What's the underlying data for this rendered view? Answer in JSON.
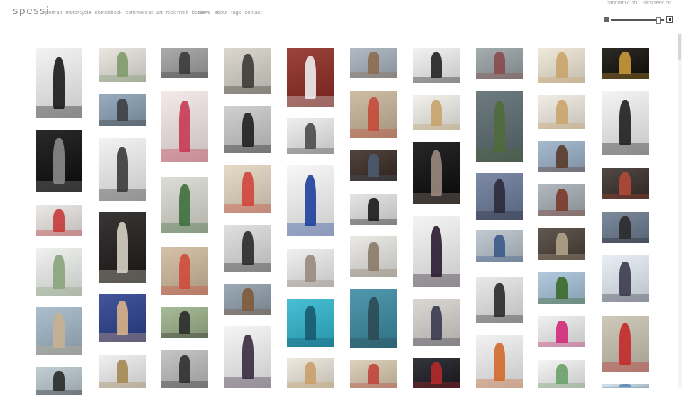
{
  "site": {
    "logo": "spessi",
    "nav": [
      "portrait",
      "motorcycle",
      "sketchbook",
      "commercial",
      "art",
      "rock'n'roll",
      "books"
    ],
    "nav_secondary": [
      "news",
      "about",
      "tags",
      "contact"
    ],
    "top_links": [
      "panoramic on",
      "fullscreen on"
    ]
  },
  "zoom": {
    "level": 0.88
  },
  "columns": [
    {
      "items": [
        {
          "name": "photo-man-in-black-studio",
          "colors": [
            "#f2f2f2",
            "#1a1a1a"
          ]
        },
        {
          "name": "photo-nude-man-dark",
          "colors": [
            "#0c0c0c",
            "#8a8a8a"
          ]
        },
        {
          "name": "photo-motorcycle-handlebars-poster",
          "colors": [
            "#e9e5e2",
            "#c53a3a"
          ]
        },
        {
          "name": "photo-album-cover-white",
          "colors": [
            "#eef0ed",
            "#8aa37c"
          ]
        },
        {
          "name": "photo-two-men-at-table",
          "colors": [
            "#a2b6c6",
            "#c7b190"
          ]
        },
        {
          "name": "photo-handlebars-sky",
          "colors": [
            "#b9c8cf",
            "#2a2a2a"
          ]
        }
      ]
    },
    {
      "items": [
        {
          "name": "photo-booklet-landscapes",
          "colors": [
            "#e6e4dc",
            "#7f9a6a"
          ]
        },
        {
          "name": "photo-motorcycle-rally-crowd",
          "colors": [
            "#8aa1b5",
            "#3d3f42"
          ]
        },
        {
          "name": "photo-boy-helmet-poster",
          "colors": [
            "#f1f1f1",
            "#3a3a3a"
          ]
        },
        {
          "name": "photo-blackboard-menu",
          "colors": [
            "#1e1a1a",
            "#d6d0c3"
          ]
        },
        {
          "name": "photo-mugshot-prisoner",
          "colors": [
            "#2a3f8e",
            "#d9b289"
          ]
        },
        {
          "name": "photo-bowl-and-spoon",
          "colors": [
            "#efefef",
            "#a48a52"
          ]
        }
      ]
    },
    {
      "items": [
        {
          "name": "photo-street-bw",
          "colors": [
            "#a0a0a0",
            "#3b3b3b"
          ]
        },
        {
          "name": "photo-spessi-poster-band",
          "colors": [
            "#f3e7e7",
            "#c73a54"
          ]
        },
        {
          "name": "photo-diner-sign-poster",
          "colors": [
            "#d8d9cf",
            "#3e6f3f"
          ]
        },
        {
          "name": "photo-two-women-at-table",
          "colors": [
            "#cfb99c",
            "#cf4a3c"
          ]
        },
        {
          "name": "photo-chopper-handlebar-road",
          "colors": [
            "#9cb28a",
            "#2b2b2b"
          ]
        },
        {
          "name": "photo-culture-book-cover",
          "colors": [
            "#bdbdbd",
            "#2f2f2f"
          ]
        }
      ]
    },
    {
      "items": [
        {
          "name": "photo-dancing-couple",
          "colors": [
            "#d6d2c9",
            "#3d3a36"
          ]
        },
        {
          "name": "photo-dragster-bw",
          "colors": [
            "#c9c9c9",
            "#1f1f1f"
          ]
        },
        {
          "name": "photo-two-girls-at-table",
          "colors": [
            "#e3d6c0",
            "#d0453a"
          ]
        },
        {
          "name": "photo-woman-black-dress-bw",
          "colors": [
            "#dcdcdc",
            "#2a2a2a"
          ]
        },
        {
          "name": "photo-beach-hut-motorcycle",
          "colors": [
            "#8f9fad",
            "#7f5a3a"
          ]
        },
        {
          "name": "photo-woman-floral-dress",
          "colors": [
            "#f4f4f4",
            "#3a2a3f"
          ]
        }
      ]
    },
    {
      "items": [
        {
          "name": "photo-man-stage-red-curtain",
          "colors": [
            "#8d2a22",
            "#ececec"
          ]
        },
        {
          "name": "photo-kitchen-mixer",
          "colors": [
            "#ececec",
            "#4a4a4a"
          ]
        },
        {
          "name": "photo-blue-sequin-walker",
          "colors": [
            "#f7f7f7",
            "#1e3f9c"
          ]
        },
        {
          "name": "photo-white-book-portrait",
          "colors": [
            "#eeeeee",
            "#9a8a80"
          ]
        },
        {
          "name": "photo-cyan-gas-station",
          "colors": [
            "#2fb6cf",
            "#1a5a6f"
          ]
        },
        {
          "name": "photo-tray-red-flower",
          "colors": [
            "#ece6da",
            "#c9a06a"
          ]
        }
      ]
    },
    {
      "items": [
        {
          "name": "photo-old-storefronts",
          "colors": [
            "#a7b2bd",
            "#8c6c4f"
          ]
        },
        {
          "name": "photo-two-boys-at-table",
          "colors": [
            "#c9b59a",
            "#c54a3a"
          ]
        },
        {
          "name": "photo-man-on-sofa",
          "colors": [
            "#3a2a23",
            "#4a5a70"
          ]
        },
        {
          "name": "photo-chopper-bw",
          "colors": [
            "#e2e2e2",
            "#1a1a1a"
          ]
        },
        {
          "name": "photo-open-book-photos",
          "colors": [
            "#e8e6e2",
            "#8a7a68"
          ]
        },
        {
          "name": "photo-teal-street",
          "colors": [
            "#3a8aa2",
            "#2c4a54"
          ]
        },
        {
          "name": "photo-two-kids-table",
          "colors": [
            "#d9c9b0",
            "#c0453a"
          ]
        }
      ]
    },
    {
      "items": [
        {
          "name": "photo-frying-pan",
          "colors": [
            "#f1f1f1",
            "#222222"
          ]
        },
        {
          "name": "photo-plate-on-tray",
          "colors": [
            "#f1efe8",
            "#c7a46a"
          ]
        },
        {
          "name": "photo-nude-woman-dark",
          "colors": [
            "#0a0a0a",
            "#9a8a80"
          ]
        },
        {
          "name": "photo-woman-dark-dress",
          "colors": [
            "#f3f3f3",
            "#2a1a2f"
          ]
        },
        {
          "name": "photo-couple-portrait",
          "colors": [
            "#d6d2cd",
            "#3a3a4f"
          ]
        },
        {
          "name": "photo-men-in-hats-night",
          "colors": [
            "#1a1a22",
            "#b52a2a"
          ]
        }
      ]
    },
    {
      "items": [
        {
          "name": "photo-street-crowd",
          "colors": [
            "#9aa2a5",
            "#8a4a4a"
          ]
        },
        {
          "name": "photo-woman-in-field",
          "colors": [
            "#5a6a6f",
            "#4f6a3a"
          ]
        },
        {
          "name": "photo-man-lying-rocks",
          "colors": [
            "#6a7a9a",
            "#2a2a3a"
          ]
        },
        {
          "name": "photo-storefront-people",
          "colors": [
            "#b8c2cb",
            "#3a5a8a"
          ]
        },
        {
          "name": "photo-bald-man-bw",
          "colors": [
            "#e6e6e6",
            "#2a2a2a"
          ]
        },
        {
          "name": "photo-boy-orange-shirt",
          "colors": [
            "#f1f1f1",
            "#d26a2a"
          ]
        }
      ]
    },
    {
      "items": [
        {
          "name": "photo-tray-clock",
          "colors": [
            "#efe7d6",
            "#c9a46a"
          ]
        },
        {
          "name": "photo-tray-plate",
          "colors": [
            "#f0ebe0",
            "#c9a46a"
          ]
        },
        {
          "name": "photo-warehouse-street",
          "colors": [
            "#9ab0c8",
            "#5a3a2a"
          ]
        },
        {
          "name": "photo-brick-buildings",
          "colors": [
            "#a6aeb5",
            "#7a3a2a"
          ]
        },
        {
          "name": "photo-bar-interior",
          "colors": [
            "#4a4038",
            "#b0a48a"
          ]
        },
        {
          "name": "photo-blue-motorcycle-field",
          "colors": [
            "#a7c2d9",
            "#3a6a2a"
          ]
        },
        {
          "name": "photo-magazine-pink",
          "colors": [
            "#eeeeee",
            "#cf2a7a"
          ]
        },
        {
          "name": "photo-white-book",
          "colors": [
            "#f3f3f3",
            "#6aa26a"
          ]
        }
      ]
    },
    {
      "items": [
        {
          "name": "photo-night-crowd",
          "colors": [
            "#120f0a",
            "#c99a3a"
          ]
        },
        {
          "name": "photo-man-glasses-poster",
          "colors": [
            "#f3f3f3",
            "#1e1e1e"
          ]
        },
        {
          "name": "photo-man-sitting-shop",
          "colors": [
            "#3a2f2a",
            "#b04a3a"
          ]
        },
        {
          "name": "photo-man-handlebars",
          "colors": [
            "#6a7a8f",
            "#2a2a2a"
          ]
        },
        {
          "name": "photo-person-in-snow",
          "colors": [
            "#e4ecf4",
            "#3a3a4a"
          ]
        },
        {
          "name": "photo-svepp-cans",
          "colors": [
            "#c9c2b0",
            "#c32a2a"
          ]
        },
        {
          "name": "photo-blue-edge",
          "colors": [
            "#cfe2ee",
            "#5a8ab0"
          ]
        }
      ]
    }
  ]
}
